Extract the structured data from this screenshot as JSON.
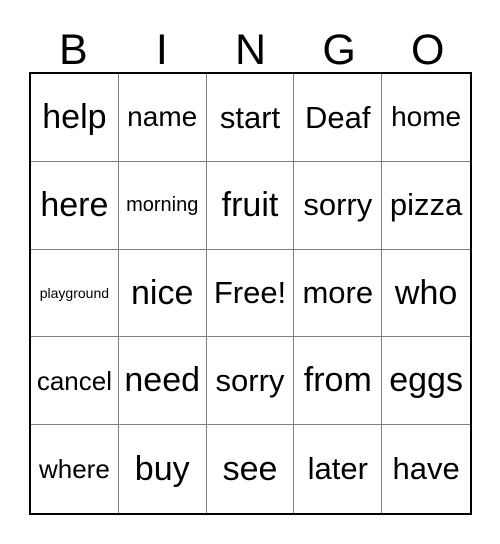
{
  "card": {
    "title": "BINGO",
    "header_letters": [
      "B",
      "I",
      "N",
      "G",
      "O"
    ],
    "colors": {
      "background": "#ffffff",
      "text": "#000000",
      "outer_border": "#000000",
      "inner_grid_line": "#808080"
    },
    "grid_size": "5x5",
    "free_space": "Free!",
    "rows": [
      [
        {
          "text": "help",
          "size": "s-xxl"
        },
        {
          "text": "name",
          "size": "s-lg"
        },
        {
          "text": "start",
          "size": "s-xl"
        },
        {
          "text": "Deaf",
          "size": "s-xl"
        },
        {
          "text": "home",
          "size": "s-lg"
        }
      ],
      [
        {
          "text": "here",
          "size": "s-xxl"
        },
        {
          "text": "morning",
          "size": "s-sm"
        },
        {
          "text": "fruit",
          "size": "s-xxl"
        },
        {
          "text": "sorry",
          "size": "s-xl"
        },
        {
          "text": "pizza",
          "size": "s-xl"
        }
      ],
      [
        {
          "text": "playground",
          "size": "s-xs"
        },
        {
          "text": "nice",
          "size": "s-xxl"
        },
        {
          "text": "Free!",
          "size": "s-xl"
        },
        {
          "text": "more",
          "size": "s-xl"
        },
        {
          "text": "who",
          "size": "s-xxl"
        }
      ],
      [
        {
          "text": "cancel",
          "size": "s-md"
        },
        {
          "text": "need",
          "size": "s-xxl"
        },
        {
          "text": "sorry",
          "size": "s-xl"
        },
        {
          "text": "from",
          "size": "s-xxl"
        },
        {
          "text": "eggs",
          "size": "s-xxl"
        }
      ],
      [
        {
          "text": "where",
          "size": "s-md"
        },
        {
          "text": "buy",
          "size": "s-xxl"
        },
        {
          "text": "see",
          "size": "s-xxl"
        },
        {
          "text": "later",
          "size": "s-xl"
        },
        {
          "text": "have",
          "size": "s-xl"
        }
      ]
    ]
  }
}
